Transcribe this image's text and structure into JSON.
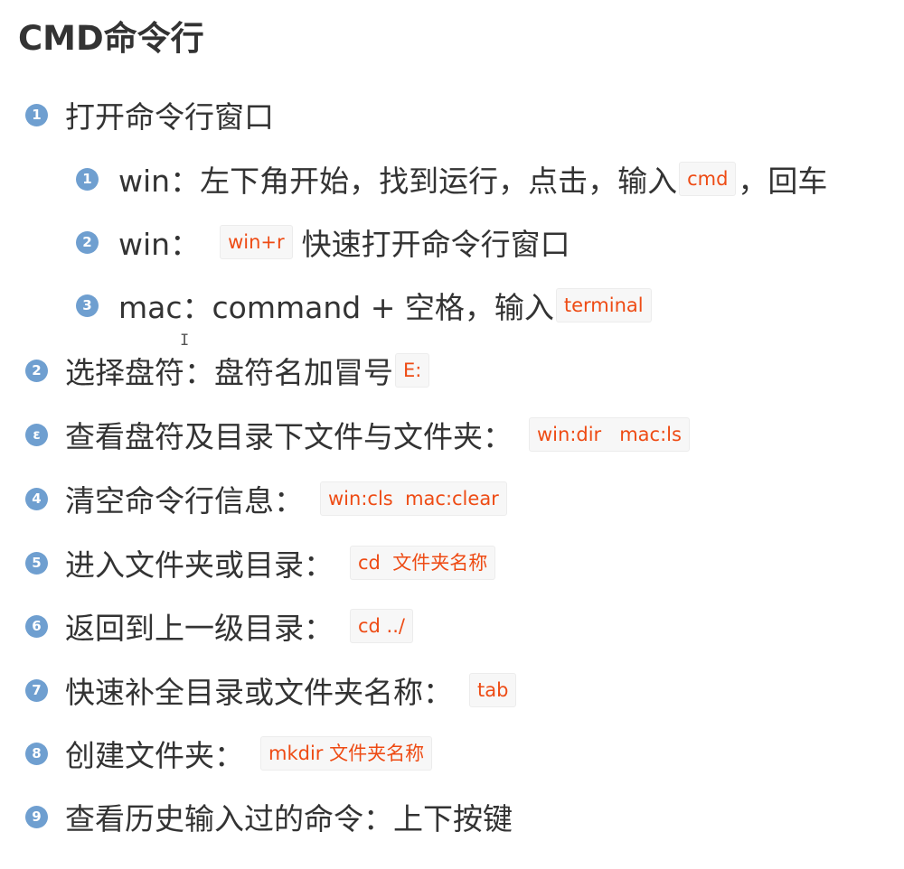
{
  "title": "CMD命令行",
  "items": [
    {
      "num": "1",
      "text": "打开命令行窗口"
    },
    {
      "num": "1",
      "text": "win：左下角开始，找到运行，点击，输入",
      "code": "cmd",
      "suffix": "，回车"
    },
    {
      "num": "2",
      "text": "win：",
      "code": "win+r",
      "suffix": "快速打开命令行窗口"
    },
    {
      "num": "3",
      "text": "mac：command + 空格，输入",
      "code": "terminal"
    },
    {
      "num": "2",
      "text": "选择盘符：盘符名加冒号",
      "code": "E:"
    },
    {
      "num": "ɛ",
      "text": "查看盘符及目录下文件与文件夹：",
      "code": "win:dir   mac:ls"
    },
    {
      "num": "4",
      "text": "清空命令行信息：",
      "code": "win:cls  mac:clear"
    },
    {
      "num": "5",
      "text": "进入文件夹或目录：",
      "code": "cd  文件夹名称"
    },
    {
      "num": "6",
      "text": "返回到上一级目录：",
      "code": "cd ../"
    },
    {
      "num": "7",
      "text": "快速补全目录或文件夹名称：",
      "code": "tab"
    },
    {
      "num": "8",
      "text": "创建文件夹：",
      "code": "mkdir 文件夹名称"
    },
    {
      "num": "9",
      "text": "查看历史输入过的命令：上下按键"
    }
  ],
  "cursor_glyph": "I",
  "colors": {
    "badge": "#6f9fd0",
    "code_text": "#ee4b14",
    "code_bg": "#f7f7f7",
    "text": "#333333"
  }
}
